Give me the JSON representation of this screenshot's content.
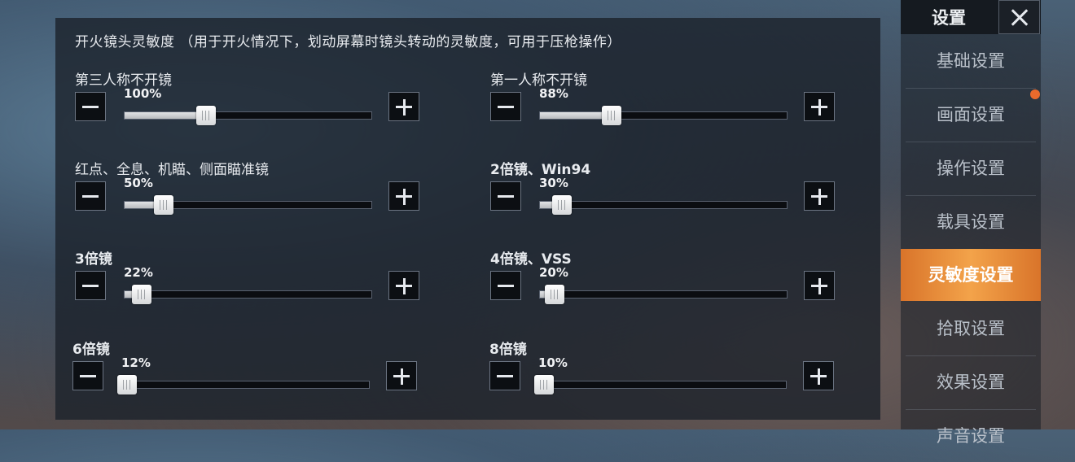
{
  "section_title": "开火镜头灵敏度 （用于开火情况下，划动屏幕时镜头转动的灵敏度，可用于压枪操作）",
  "sliders": [
    {
      "label": "第三人称不开镜",
      "value_text": "100%",
      "fraction": 0.33
    },
    {
      "label": "第一人称不开镜",
      "value_text": "88%",
      "fraction": 0.29
    },
    {
      "label": "红点、全息、机瞄、侧面瞄准镜",
      "value_text": "50%",
      "fraction": 0.16
    },
    {
      "label": "2倍镜、Win94",
      "value_text": "30%",
      "fraction": 0.09
    },
    {
      "label": "3倍镜",
      "value_text": "22%",
      "fraction": 0.07
    },
    {
      "label": "4倍镜、VSS",
      "value_text": "20%",
      "fraction": 0.06
    },
    {
      "label": "6倍镜",
      "value_text": "12%",
      "fraction": 0.02
    },
    {
      "label": "8倍镜",
      "value_text": "10%",
      "fraction": 0.02
    }
  ],
  "sidebar": {
    "title": "设置",
    "items": [
      {
        "label": "基础设置"
      },
      {
        "label": "画面设置"
      },
      {
        "label": "操作设置"
      },
      {
        "label": "载具设置"
      },
      {
        "label": "灵敏度设置"
      },
      {
        "label": "拾取设置"
      },
      {
        "label": "效果设置"
      },
      {
        "label": "声音设置"
      }
    ],
    "active_index": 4
  },
  "icons": {
    "minus": "minus-icon",
    "plus": "plus-icon",
    "close": "close-icon"
  },
  "colors": {
    "accent": "#f0953e",
    "notify": "#ea6a2c"
  }
}
